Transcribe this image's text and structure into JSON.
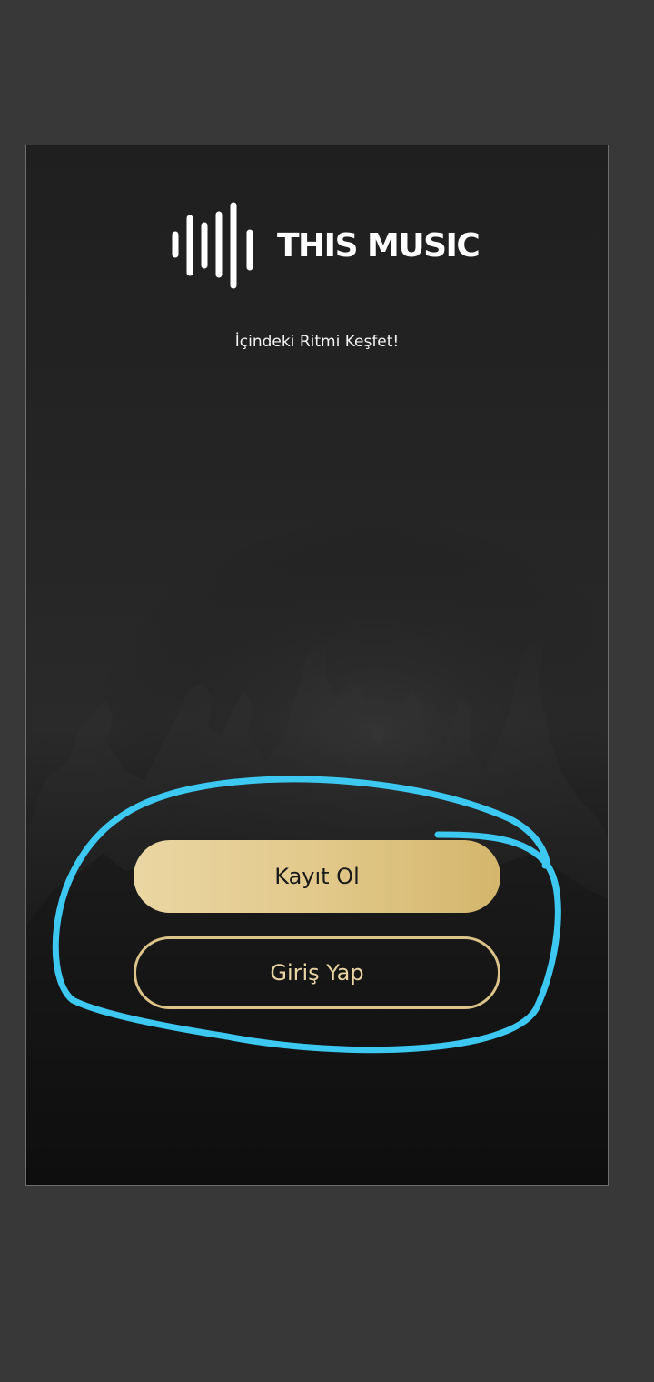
{
  "app": {
    "name": "THIS MUSIC",
    "tagline": "İçindeki Ritmi Keşfet!"
  },
  "actions": {
    "register_label": "Kayıt Ol",
    "login_label": "Giriş Yap"
  },
  "colors": {
    "outer_background": "#383838",
    "screen_background": "#1f1f1f",
    "gold_accent": "#dcc38a",
    "annotation_stroke": "#3cc8f0"
  },
  "icons": {
    "logo": "sound-wave-icon"
  },
  "annotation": {
    "type": "hand-drawn-circle",
    "target": "action-buttons"
  }
}
